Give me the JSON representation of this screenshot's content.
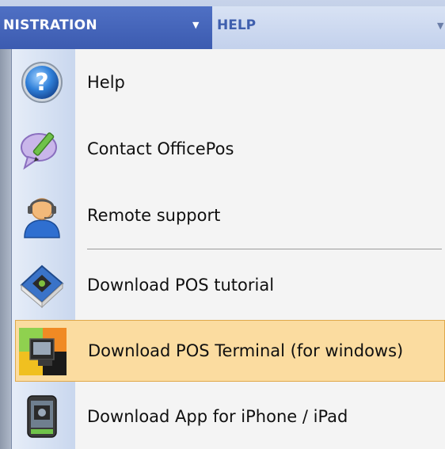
{
  "menubar": {
    "admin_label": "NISTRATION",
    "help_label": "HELP"
  },
  "dropdown": {
    "items": [
      {
        "label": "Help",
        "icon": "help-icon"
      },
      {
        "label": "Contact OfficePos",
        "icon": "contact-speech-icon"
      },
      {
        "label": "Remote support",
        "icon": "headset-user-icon"
      },
      {
        "label": "Download POS tutorial",
        "icon": "book-icon"
      },
      {
        "label": "Download POS Terminal (for windows)",
        "icon": "pos-terminal-icon"
      },
      {
        "label": "Download App for iPhone / iPad",
        "icon": "phone-app-icon"
      }
    ],
    "selected_index": 4
  },
  "colors": {
    "admin_bg": "#3c5bb0",
    "help_text": "#3f5fae",
    "highlight": "#fbdca0",
    "highlight_border": "#e0a84a"
  }
}
